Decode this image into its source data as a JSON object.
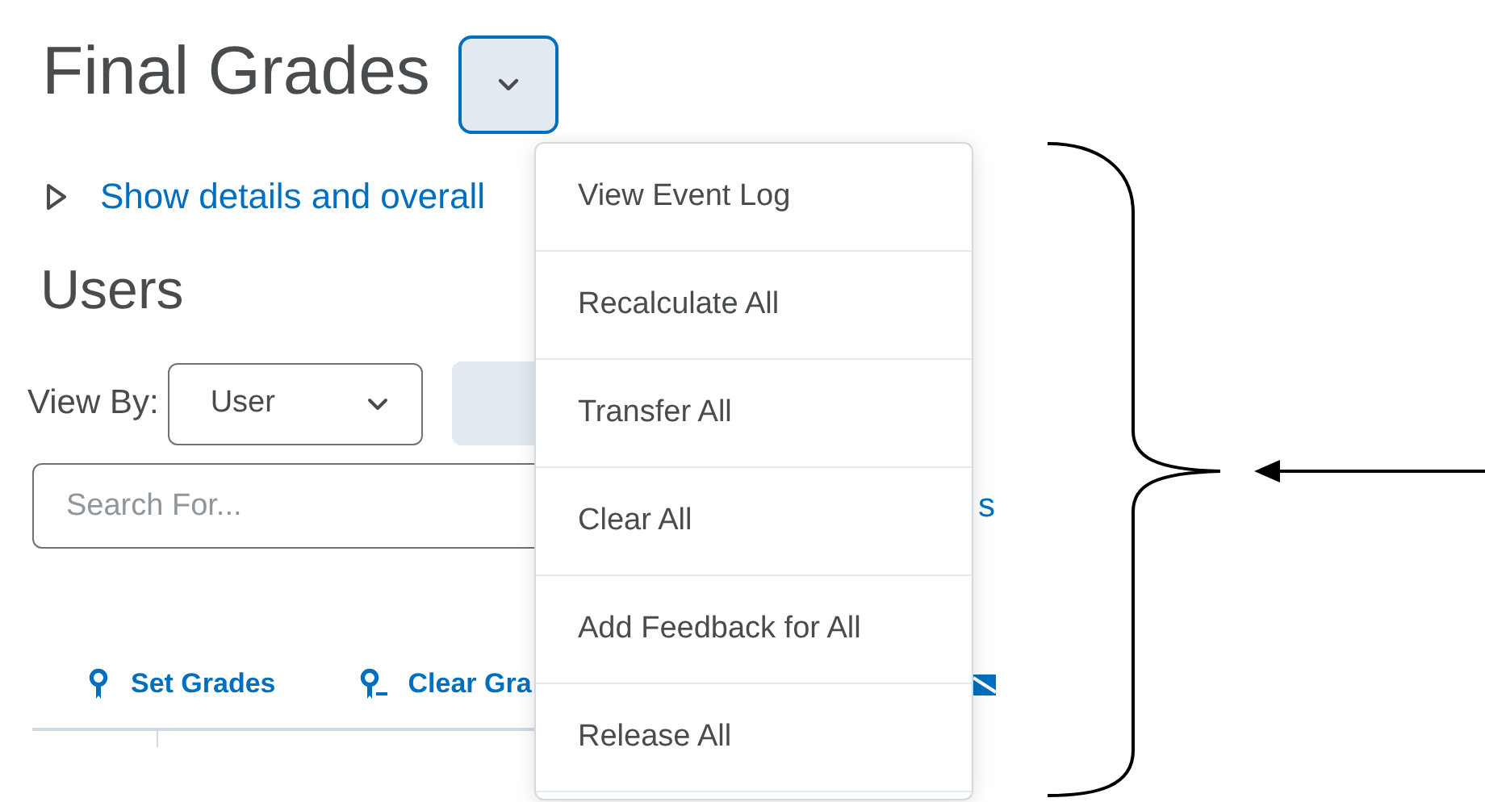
{
  "header": {
    "title": "Final Grades",
    "menu_button": {
      "expanded": true
    }
  },
  "details_toggle": {
    "label": "Show details and overall",
    "expanded": false
  },
  "section_title": "Users",
  "view_by": {
    "label": "View By:",
    "value": "User"
  },
  "search": {
    "placeholder": "Search For...",
    "link": "s"
  },
  "toolbar": [
    {
      "label": "Set Grades",
      "kind": "set"
    },
    {
      "label": "Clear Gra",
      "kind": "clear"
    },
    {
      "kind": "email"
    }
  ],
  "actions_menu": {
    "open": true,
    "items": [
      {
        "label": "View Event Log"
      },
      {
        "label": "Recalculate All"
      },
      {
        "label": "Transfer All"
      },
      {
        "label": "Clear All"
      },
      {
        "label": "Add Feedback for All"
      },
      {
        "label": "Release All"
      }
    ]
  }
}
